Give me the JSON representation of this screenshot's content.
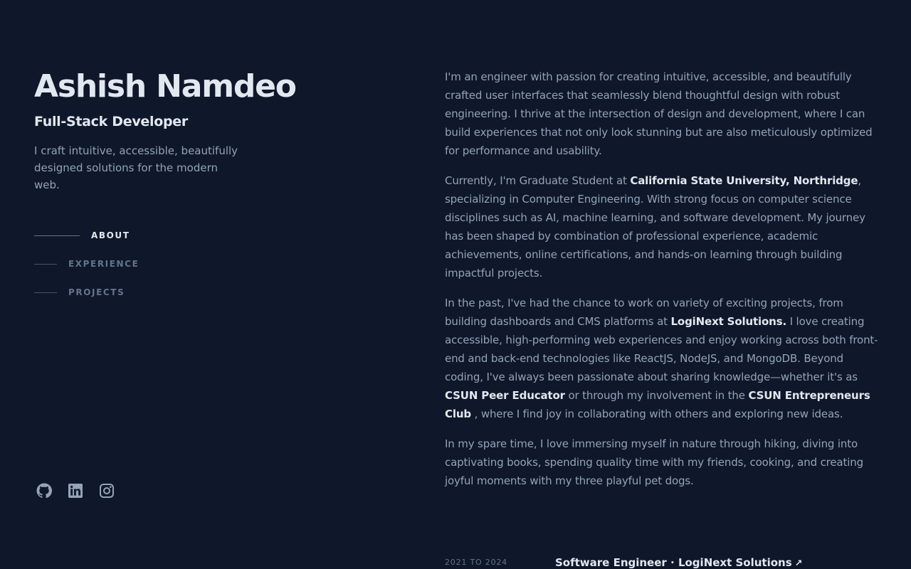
{
  "header": {
    "name": "Ashish Namdeo",
    "role": "Full-Stack Developer",
    "tagline": "I craft intuitive, accessible, beautifully designed solutions for the modern web."
  },
  "nav": {
    "items": [
      {
        "label": "ABOUT",
        "active": true
      },
      {
        "label": "EXPERIENCE",
        "active": false
      },
      {
        "label": "PROJECTS",
        "active": false
      }
    ]
  },
  "socials": [
    "github-icon",
    "linkedin-icon",
    "instagram-icon"
  ],
  "about": {
    "p1": "I'm an engineer with passion for creating intuitive, accessible, and beautifully crafted user interfaces that seamlessly blend thoughtful design with robust engineering. I thrive at the intersection of design and development, where I can build experiences that not only look stunning but are also meticulously optimized for performance and usability.",
    "p2_a": "Currently, I'm Graduate Student at ",
    "p2_link": "California State University, Northridge",
    "p2_b": ", specializing in Computer Engineering. With strong focus on computer science disciplines such as AI, machine learning, and software development. My journey has been shaped by combination of professional experience, academic achievements, online certifications, and hands-on learning through building impactful projects.",
    "p3_a": "In the past, I've had the chance to work on variety of exciting projects, from building dashboards and CMS platforms at ",
    "p3_link1": "LogiNext Solutions.",
    "p3_b": " I love creating accessible, high-performing web experiences and enjoy working across both front-end and back-end technologies like ReactJS, NodeJS, and MongoDB. Beyond coding, I've always been passionate about sharing knowledge—whether it's as ",
    "p3_link2": "CSUN Peer Educator",
    "p3_c": " or through my involvement in the ",
    "p3_link3": "CSUN Entrepreneurs Club",
    "p3_d": " , where I find joy in collaborating with others and exploring new ideas.",
    "p4": "In my spare time, I love immersing myself in nature through hiking, diving into captivating books, spending quality time with my friends, cooking, and creating joyful moments with my three playful pet dogs."
  },
  "experience": {
    "date": "2021 TO 2024",
    "title": "Software Engineer · LogiNext Solutions",
    "arrow": "↗"
  }
}
